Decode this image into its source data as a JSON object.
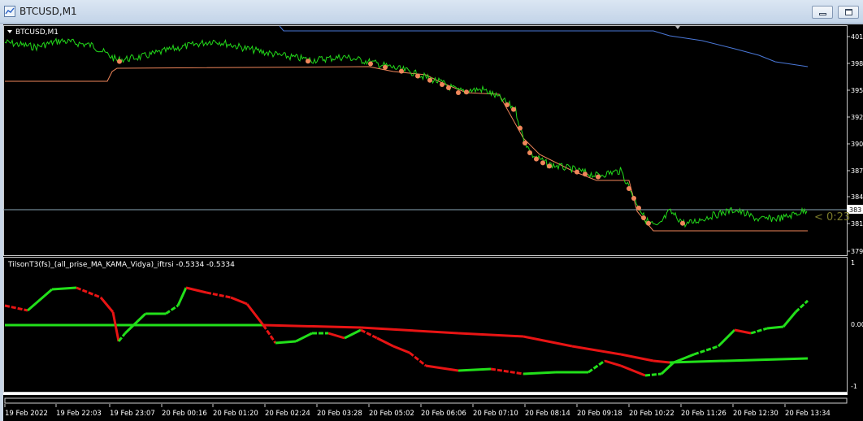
{
  "window": {
    "title": "BTCUSD,M1"
  },
  "main_panel": {
    "label": "BTCUSD,M1",
    "price_ticks": [
      "401",
      "398",
      "395",
      "392",
      "390",
      "387",
      "384",
      "381",
      "379"
    ],
    "current_price_tag": "383",
    "countdown": "< 0:23",
    "colors": {
      "price": "#22d81a",
      "ma": "#f0865a",
      "upper": "#4a78d8",
      "hline": "#8aa8b8"
    }
  },
  "indicator_panel": {
    "label": "TilsonT3(fs)_(all_prise_MA_KAMA_Vidya)_iftrsi -0.5334 -0.5334",
    "ticks": [
      "1",
      "0.00",
      "-1"
    ],
    "colors": {
      "up": "#22e01a",
      "down": "#e81414"
    }
  },
  "time_axis": {
    "labels": [
      "19 Feb 2022",
      "19 Feb 22:03",
      "19 Feb 23:07",
      "20 Feb 00:16",
      "20 Feb 01:20",
      "20 Feb 02:24",
      "20 Feb 03:28",
      "20 Feb 05:02",
      "20 Feb 06:06",
      "20 Feb 07:10",
      "20 Feb 08:14",
      "20 Feb 09:18",
      "20 Feb 10:22",
      "20 Feb 11:26",
      "20 Feb 12:30",
      "20 Feb 13:34"
    ]
  }
}
